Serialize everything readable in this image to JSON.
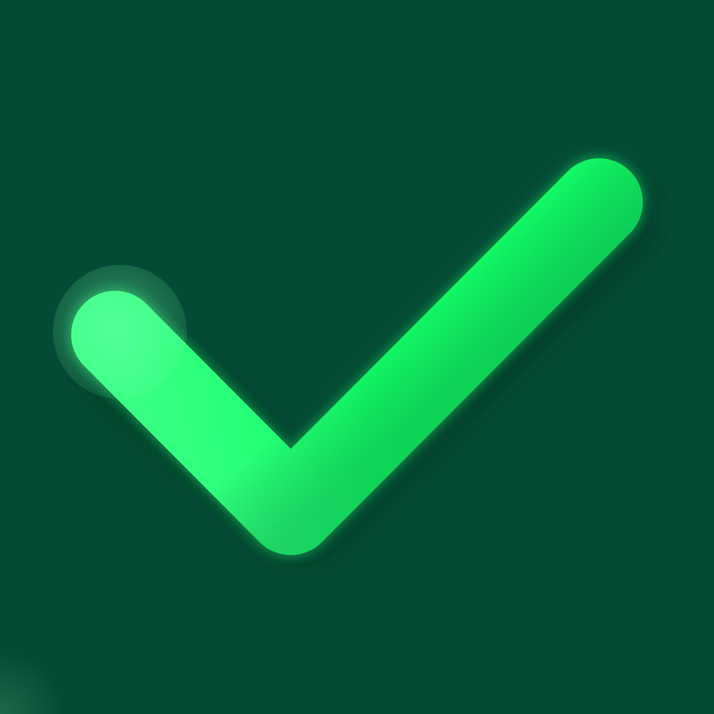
{
  "icon": {
    "name": "checkmark-icon",
    "colors": {
      "background": "#044b35",
      "check_primary": "#10ff66",
      "check_highlight": "#48ff8c",
      "check_shadow": "#0bd857"
    }
  }
}
